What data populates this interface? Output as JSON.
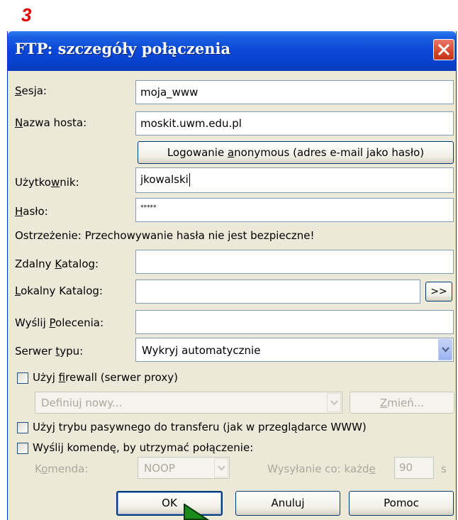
{
  "step_number": "3",
  "window": {
    "title": "FTP: szczegóły połączenia"
  },
  "fields": {
    "session": {
      "label_accel": "S",
      "label_rest": "esja:",
      "value": "moja_www"
    },
    "host": {
      "label_accel": "N",
      "label_rest": "azwa hosta:",
      "value": "moskit.uwm.edu.pl"
    },
    "anonymous_button": {
      "pre": "Logowanie ",
      "accel": "a",
      "post": "nonymous (adres e-mail jako hasło)"
    },
    "user": {
      "label_pre": "Użytko",
      "label_accel": "w",
      "label_post": "nik:",
      "value": "jkowalski"
    },
    "password": {
      "label_accel": "H",
      "label_rest": "asło:",
      "value": "*****"
    },
    "warning": "Ostrzeżenie: Przechowywanie hasła nie jest bezpieczne!",
    "remote_dir": {
      "label_pre": "Zdalny ",
      "label_accel": "K",
      "label_post": "atalog:",
      "value": ""
    },
    "local_dir": {
      "label_accel": "L",
      "label_rest": "okalny Katalog:",
      "value": "",
      "browse_label": ">>"
    },
    "commands": {
      "label_pre": "Wyślij ",
      "label_accel": "P",
      "label_post": "olecenia:",
      "value": ""
    },
    "server_type": {
      "label_pre": "Serwer ",
      "label_accel": "t",
      "label_post": "ypu:",
      "value": "Wykryj automatycznie"
    }
  },
  "firewall": {
    "checkbox_pre": "Użyj ",
    "checkbox_accel": "f",
    "checkbox_post": "irewall (serwer proxy)",
    "checked": false,
    "proxy_select_value": "Definiuj nowy...",
    "change_pre": "",
    "change_accel": "Z",
    "change_post": "mień..."
  },
  "passive": {
    "checkbox_label": "Użyj trybu pasywnego do transferu (jak w przeglądarce WWW)",
    "checked": false
  },
  "keepalive": {
    "checkbox_label": "Wyślij komendę, by utrzymać połączenie:",
    "checked": false,
    "command_label_pre": "K",
    "command_label_accel": "o",
    "command_label_post": "menda:",
    "command_value": "NOOP",
    "interval_label_pre": "Wysyłanie co: każd",
    "interval_label_accel": "e",
    "interval_value": "90",
    "interval_unit": "s"
  },
  "buttons": {
    "ok": "OK",
    "cancel": "Anuluj",
    "help": "Pomoc"
  },
  "colors": {
    "titlebar": "#0a46d8",
    "dialog_bg": "#ece9d8",
    "step_number": "#e00000",
    "cursor": "#1a8a1a"
  }
}
